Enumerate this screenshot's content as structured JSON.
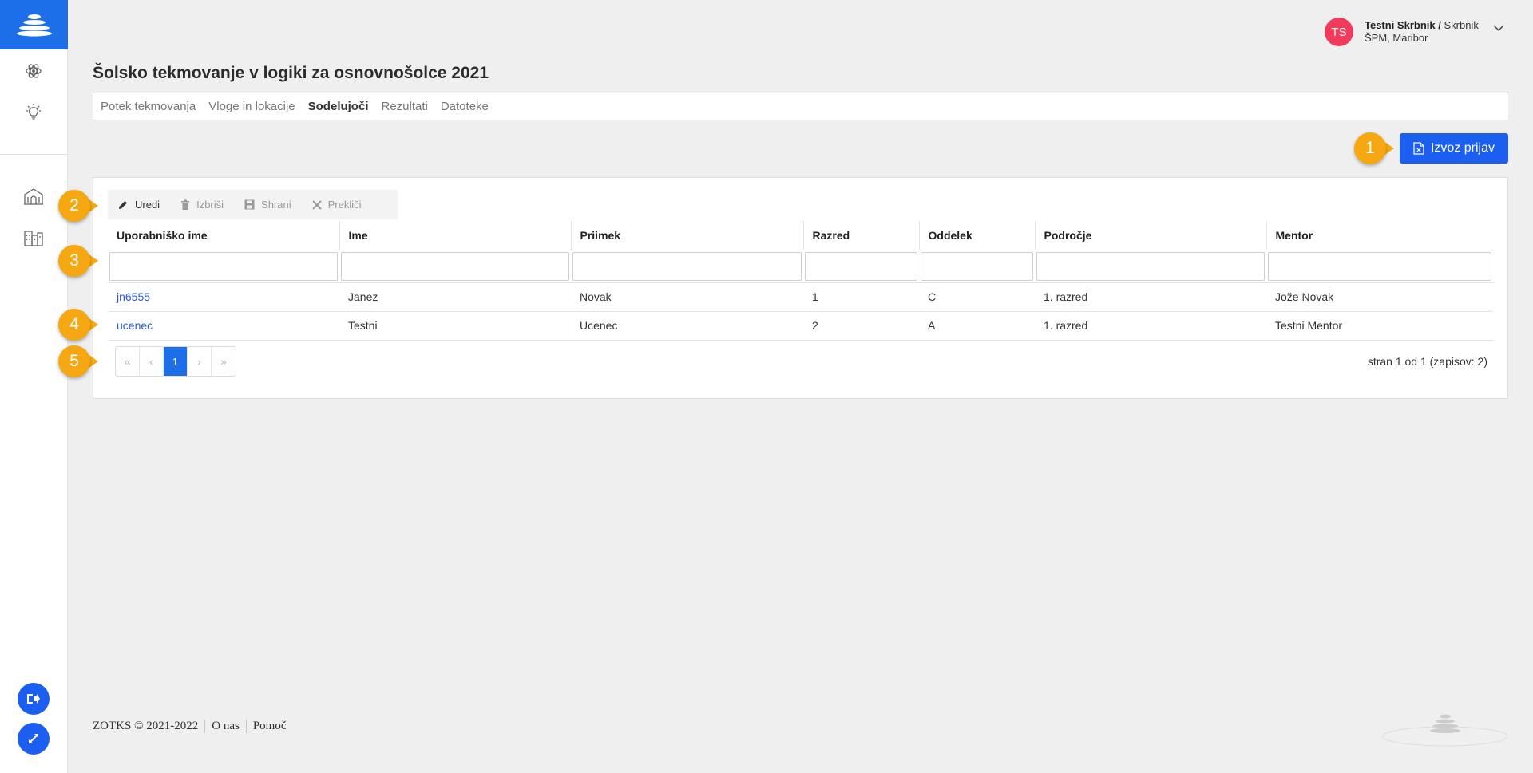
{
  "user": {
    "initials": "TS",
    "name": "Testni Skrbnik /",
    "role": "Skrbnik",
    "org": "ŠPM, Maribor"
  },
  "page": {
    "title": "Šolsko tekmovanje v logiki za osnovnošolce 2021"
  },
  "tabs": [
    {
      "label": "Potek tekmovanja"
    },
    {
      "label": "Vloge in lokacije"
    },
    {
      "label": "Sodelujoči"
    },
    {
      "label": "Rezultati"
    },
    {
      "label": "Datoteke"
    }
  ],
  "export_button": {
    "label": "Izvoz prijav"
  },
  "toolbar": {
    "edit": "Uredi",
    "delete": "Izbriši",
    "save": "Shrani",
    "cancel": "Prekliči"
  },
  "table": {
    "columns": [
      "Uporabniško ime",
      "Ime",
      "Priimek",
      "Razred",
      "Oddelek",
      "Področje",
      "Mentor"
    ],
    "rows": [
      [
        "jn6555",
        "Janez",
        "Novak",
        "1",
        "C",
        "1. razred",
        "Jože Novak"
      ],
      [
        "ucenec",
        "Testni",
        "Ucenec",
        "2",
        "A",
        "1. razred",
        "Testni Mentor"
      ]
    ]
  },
  "pager": {
    "first": "«",
    "prev": "‹",
    "current": "1",
    "next": "›",
    "last": "»",
    "info": "stran 1 od 1 (zapisov: 2)"
  },
  "callouts": [
    "1",
    "2",
    "3",
    "4",
    "5"
  ],
  "footer": {
    "copyright": "ZOTKS © 2021-2022",
    "about": "O nas",
    "help": "Pomoč"
  },
  "colors": {
    "primary": "#1c5ef0",
    "callout": "#f5a812",
    "avatar": "#f23a5d"
  }
}
